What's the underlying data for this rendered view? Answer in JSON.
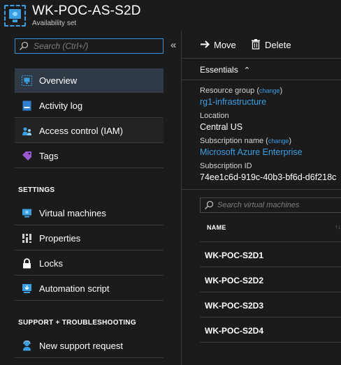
{
  "header": {
    "title": "WK-POC-AS-S2D",
    "subtitle": "Availability set",
    "icon": "availability-set-icon",
    "accent_color": "#3aa0e3"
  },
  "left_panel": {
    "search_placeholder": "Search (Ctrl+/)",
    "collapse_glyph": "«",
    "nav_items": [
      {
        "label": "Overview",
        "icon": "overview-icon",
        "active": true
      },
      {
        "label": "Activity log",
        "icon": "activity-log-icon"
      },
      {
        "label": "Access control (IAM)",
        "icon": "access-control-icon"
      },
      {
        "label": "Tags",
        "icon": "tag-icon"
      }
    ],
    "settings_title": "SETTINGS",
    "settings_items": [
      {
        "label": "Virtual machines",
        "icon": "virtual-machine-icon"
      },
      {
        "label": "Properties",
        "icon": "properties-icon"
      },
      {
        "label": "Locks",
        "icon": "lock-icon"
      },
      {
        "label": "Automation script",
        "icon": "automation-script-icon"
      }
    ],
    "support_title": "SUPPORT + TROUBLESHOOTING",
    "support_items": [
      {
        "label": "New support request",
        "icon": "support-icon"
      }
    ]
  },
  "toolbar": {
    "move_label": "Move",
    "delete_label": "Delete"
  },
  "essentials": {
    "title": "Essentials",
    "caret": "⌃",
    "resource_group_label": "Resource group",
    "resource_group_value": "rg1-infrastructure",
    "change_label": "change",
    "location_label": "Location",
    "location_value": "Central US",
    "subscription_name_label": "Subscription name",
    "subscription_name_value": "Microsoft Azure Enterprise",
    "subscription_id_label": "Subscription ID",
    "subscription_id_value": "74ee1c6d-919c-40b3-bf6d-d6f218c"
  },
  "vm_list": {
    "search_placeholder": "Search virtual machines",
    "column_name": "NAME",
    "rows": [
      "WK-POC-S2D1",
      "WK-POC-S2D2",
      "WK-POC-S2D3",
      "WK-POC-S2D4"
    ]
  }
}
